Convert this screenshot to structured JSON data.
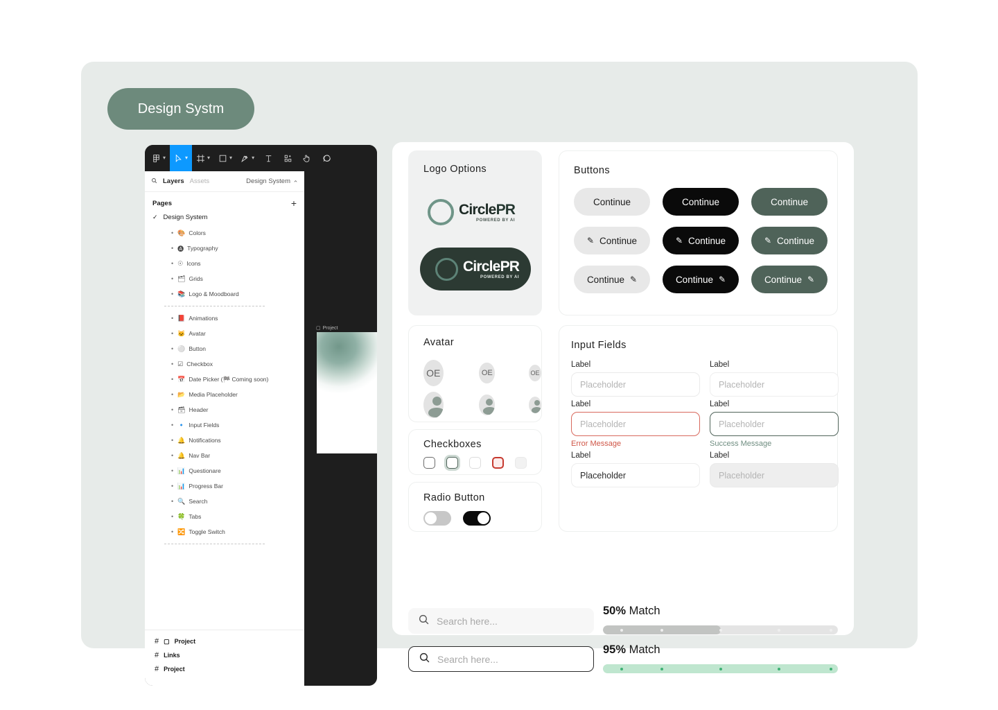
{
  "page": {
    "title_badge": "Design Systm",
    "accent_green": "#6d8a7c",
    "container_bg": "#e7ebe9"
  },
  "figma": {
    "toolbar": [
      {
        "name": "figma-menu-icon",
        "caret": "▾"
      },
      {
        "name": "move-tool-icon",
        "caret": "▾"
      },
      {
        "name": "frame-tool-icon",
        "caret": "▾"
      },
      {
        "name": "shape-tool-icon",
        "caret": "▾"
      },
      {
        "name": "pen-tool-icon",
        "caret": "▾"
      },
      {
        "name": "text-tool-icon",
        "caret": ""
      },
      {
        "name": "components-tool-icon",
        "caret": ""
      },
      {
        "name": "hand-tool-icon",
        "caret": ""
      },
      {
        "name": "comment-tool-icon",
        "caret": ""
      }
    ],
    "panel": {
      "tab_layers": "Layers",
      "tab_assets": "Assets",
      "document_name": "Design System",
      "pages_label": "Pages",
      "add_page": "+",
      "active_page": "Design System",
      "page_groups": [
        [
          {
            "emoji": "🎨",
            "label": "Colors"
          },
          {
            "emoji": "🅐",
            "label": "Typography"
          },
          {
            "emoji": "☉",
            "label": "Icons"
          },
          {
            "emoji": "🗂",
            "label": "Grids"
          },
          {
            "emoji": "📚",
            "label": "Logo & Moodboard"
          }
        ],
        [
          {
            "emoji": "📕",
            "label": "Animations"
          },
          {
            "emoji": "🐱",
            "label": "Avatar"
          },
          {
            "emoji": "⚪",
            "label": "Button"
          },
          {
            "emoji": "☑",
            "label": "Checkbox"
          },
          {
            "emoji": "📅",
            "label": "Date Picker (🏁 Coming soon)"
          },
          {
            "emoji": "📂",
            "label": "Media Placeholder"
          },
          {
            "emoji": "🗃",
            "label": "Header"
          },
          {
            "emoji": "🔹",
            "label": "Input Fields"
          },
          {
            "emoji": "🔔",
            "label": "Notifications"
          },
          {
            "emoji": "🔔",
            "label": "Nav Bar"
          },
          {
            "emoji": "📊",
            "label": "Questionare"
          },
          {
            "emoji": "📊",
            "label": "Progress Bar"
          },
          {
            "emoji": "🔍",
            "label": "Search"
          },
          {
            "emoji": "🍀",
            "label": "Tabs"
          },
          {
            "emoji": "🔀",
            "label": "Toggle Switch"
          }
        ]
      ],
      "bottom_items": [
        {
          "hash": "#",
          "icon": "▢",
          "label": "Project"
        },
        {
          "hash": "#",
          "icon": "",
          "label": "Links"
        },
        {
          "hash": "#",
          "icon": "",
          "label": "Project"
        }
      ]
    },
    "canvas": {
      "frame_label": "Project",
      "frame_icon": "▢"
    }
  },
  "logo_card": {
    "title": "Logo Options",
    "wordmark_circle": "Circle",
    "wordmark_pr": "PR",
    "tagline": "POWERED BY AI"
  },
  "buttons_card": {
    "title": "Buttons",
    "label": "Continue",
    "pencil": "✎",
    "variants": [
      {
        "style": "light",
        "icon": "none"
      },
      {
        "style": "dark",
        "icon": "none"
      },
      {
        "style": "green",
        "icon": "none"
      },
      {
        "style": "light",
        "icon": "leading"
      },
      {
        "style": "dark",
        "icon": "leading"
      },
      {
        "style": "green",
        "icon": "leading"
      },
      {
        "style": "light",
        "icon": "trailing"
      },
      {
        "style": "dark",
        "icon": "trailing"
      },
      {
        "style": "green",
        "icon": "trailing"
      }
    ]
  },
  "avatar_card": {
    "title": "Avatar",
    "initials": "OE",
    "sizes": [
      "lg",
      "md",
      "sm"
    ]
  },
  "checkbox_card": {
    "title": "Checkboxes",
    "states": [
      "default",
      "focused",
      "inactive",
      "error",
      "disabled"
    ]
  },
  "radio_card": {
    "title": "Radio Button",
    "toggles": [
      "off",
      "on"
    ]
  },
  "search": {
    "placeholder": "Search here...",
    "icon": "search-icon"
  },
  "inputs_card": {
    "title": "Input Fields",
    "label": "Label",
    "placeholder": "Placeholder",
    "error_message": "Error Message",
    "success_message": "Success Message",
    "filled_value": "Placeholder",
    "disabled_value": "Placeholder"
  },
  "match_bars": [
    {
      "percent": "50%",
      "word": "Match",
      "value": 50,
      "style": "gray",
      "ticks": [
        8,
        25,
        50,
        75,
        97
      ]
    },
    {
      "percent": "95%",
      "word": "Match",
      "value": 95,
      "style": "green",
      "ticks": [
        8,
        25,
        50,
        75,
        97
      ]
    }
  ]
}
